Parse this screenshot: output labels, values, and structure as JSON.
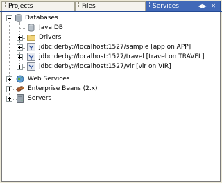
{
  "tabs": [
    {
      "label": "Projects"
    },
    {
      "label": "Files"
    },
    {
      "label": "Services"
    }
  ],
  "tab_controls": {
    "minimize": "◀▶",
    "close": "✕"
  },
  "tree": {
    "databases": {
      "label": "Databases",
      "children": [
        {
          "label": "Java DB"
        },
        {
          "label": "Drivers"
        },
        {
          "label": "jdbc:derby://localhost:1527/sample [app on APP]"
        },
        {
          "label": "jdbc:derby://localhost:1527/travel [travel on TRAVEL]"
        },
        {
          "label": "jdbc:derby://localhost:1527/vir [vir on VIR]"
        }
      ]
    },
    "web_services": {
      "label": "Web Services"
    },
    "enterprise_beans": {
      "label": "Enterprise Beans (2.x)"
    },
    "servers": {
      "label": "Servers"
    }
  }
}
